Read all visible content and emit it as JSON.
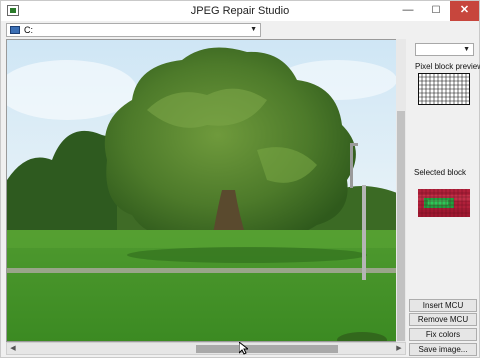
{
  "window": {
    "title": "JPEG Repair Studio",
    "minimize_glyph": "—",
    "maximize_glyph": "☐",
    "close_glyph": "✕"
  },
  "drive_combo": {
    "value": "C:",
    "icon": "drive-icon"
  },
  "sidebar": {
    "mode_combo_value": "",
    "pixel_block_preview_label": "Pixel block preview:",
    "selected_block_label": "Selected block",
    "buttons": {
      "insert_mcu": "Insert MCU",
      "remove_mcu": "Remove MCU",
      "fix_colors": "Fix colors",
      "save_image": "Save image..."
    }
  },
  "colors": {
    "close_button": "#c7463d",
    "selected_block_red": "#b0203a",
    "selected_block_green": "#20a040"
  },
  "scroll": {
    "arrow_left": "◀",
    "arrow_right": "▶",
    "arrow_down": "▼"
  }
}
